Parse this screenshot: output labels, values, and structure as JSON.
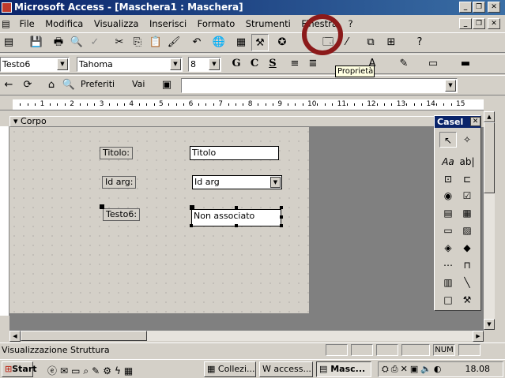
{
  "window": {
    "title": "Microsoft Access - [Maschera1 : Maschera]"
  },
  "menu": [
    "File",
    "Modifica",
    "Visualizza",
    "Inserisci",
    "Formato",
    "Strumenti",
    "Finestra",
    "?"
  ],
  "format_toolbar": {
    "object_combo": "Testo6",
    "font_combo": "Tahoma",
    "size_combo": "8",
    "bold": "G",
    "italic": "C",
    "underline": "S"
  },
  "web_toolbar": {
    "favorites": "Preferiti",
    "goto": "Vai",
    "address_value": ""
  },
  "tooltip": "Proprietà",
  "section": {
    "label": "Corpo"
  },
  "form": {
    "label_titolo": "Titolo:",
    "text_titolo": "Titolo",
    "label_idarg": "Id arg:",
    "combo_idarg": "Id arg",
    "label_testo6": "Testo6:",
    "text_testo6": "Non associato"
  },
  "ruler": {
    "numbers": [
      "1",
      "2",
      "3",
      "4",
      "5",
      "6",
      "7",
      "8",
      "9",
      "10",
      "11",
      "12",
      "13",
      "14",
      "15"
    ]
  },
  "toolbox": {
    "title": "Casel"
  },
  "status": {
    "text": "Visualizzazione Struttura",
    "num": "NUM"
  },
  "taskbar": {
    "start": "Start",
    "tasks": [
      "Collezi...",
      "access...",
      "Masc..."
    ],
    "clock": "18.08"
  },
  "colors": {
    "titlebar": "#0a246a",
    "highlight_circle": "#8b1a1a",
    "face": "#d4d0c8"
  }
}
